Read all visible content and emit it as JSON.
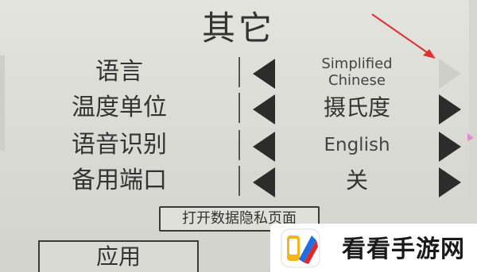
{
  "page": {
    "title": "其它"
  },
  "settings": [
    {
      "label": "语言",
      "value": "Simplified Chinese",
      "value_line1": "Simplified",
      "value_line2": "Chinese",
      "next_enabled": false
    },
    {
      "label": "温度单位",
      "value": "摄氏度",
      "next_enabled": true
    },
    {
      "label": "语音识别",
      "value": "English",
      "next_enabled": true
    },
    {
      "label": "备用端口",
      "value": "关",
      "next_enabled": true
    }
  ],
  "buttons": {
    "privacy": "打开数据隐私页面",
    "apply": "应用"
  },
  "watermark": {
    "text": "看看手游网"
  },
  "colors": {
    "background": "#dcdcd6",
    "text": "#333333",
    "arrow": "#2c2c2c",
    "annotation": "#e03030"
  },
  "icons": {
    "prev": "triangle-left-icon",
    "next": "triangle-right-icon"
  }
}
